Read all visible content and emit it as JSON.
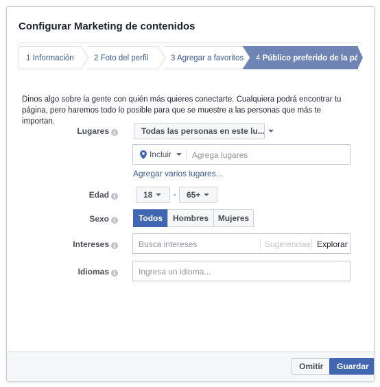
{
  "dialog": {
    "title": "Configurar Marketing de contenidos"
  },
  "steps": [
    {
      "num": "1",
      "label": "Información"
    },
    {
      "num": "2",
      "label": "Foto del perfil"
    },
    {
      "num": "3",
      "label": "Agregar a favoritos"
    },
    {
      "num": "4",
      "label": "Público preferido de la página"
    }
  ],
  "intro": "Dinos algo sobre la gente con quién más quieres conectarte. Cualquiera podrá encontrar tu página, pero haremos todo lo posible para que se muestre a las personas que más te importan.",
  "form": {
    "places": {
      "label": "Lugares",
      "dropdown_value": "Todas las personas en este lu...",
      "include_label": "Incluir",
      "placeholder": "Agrega lugares",
      "add_many_link": "Agregar varios lugares..."
    },
    "age": {
      "label": "Edad",
      "min": "18",
      "separator": "-",
      "max": "65+"
    },
    "gender": {
      "label": "Sexo",
      "options": [
        "Todos",
        "Hombres",
        "Mujeres"
      ],
      "selected": "Todos"
    },
    "interests": {
      "label": "Intereses",
      "placeholder": "Busca intereses",
      "suggestions": "Sugerencias",
      "explore": "Explorar"
    },
    "languages": {
      "label": "Idiomas",
      "placeholder": "Ingresa un idioma..."
    }
  },
  "footer": {
    "omit": "Omitir",
    "save": "Guardar"
  },
  "colors": {
    "accent": "#4267b2",
    "active_step": "#6d84b4",
    "link": "#365899"
  }
}
